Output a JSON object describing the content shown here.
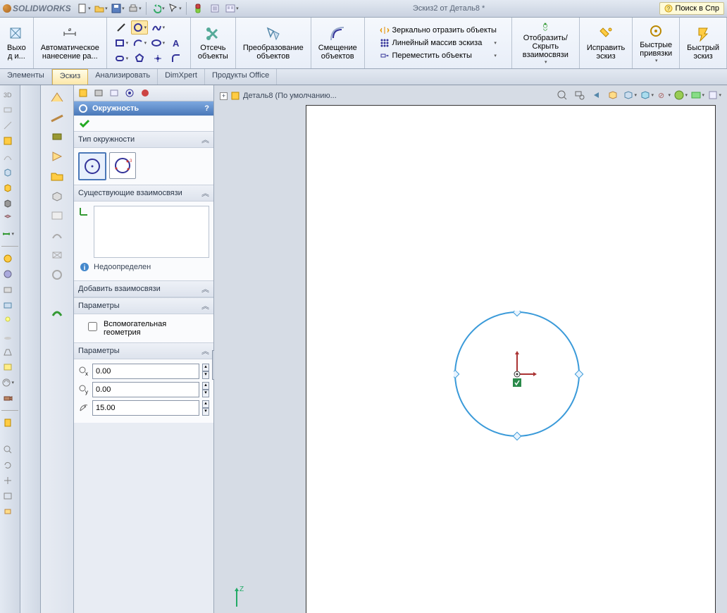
{
  "app": {
    "name": "SOLIDWORKS",
    "title": "Эскиз2 от Деталь8 *",
    "search": "Поиск в Спр"
  },
  "ribbon": {
    "exit": "Выхо\nд и...",
    "auto_dim": "Автоматическое\nнанесение ра...",
    "trim": "Отсечь\nобъекты",
    "convert": "Преобразование\nобъектов",
    "offset": "Смещение\nобъектов",
    "mirror": "Зеркально отразить объекты",
    "linear": "Линейный массив эскиза",
    "move": "Переместить объекты",
    "show_hide": "Отобразить/Скрыть\nвзаимосвязи",
    "fix": "Исправить\nэскиз",
    "quick_snap": "Быстрые\nпривязки",
    "quick_sketch": "Быстрый\nэскиз"
  },
  "tabs": {
    "features": "Элементы",
    "sketch": "Эскиз",
    "analyze": "Анализировать",
    "dimxpert": "DimXpert",
    "office": "Продукты Office"
  },
  "panel": {
    "title": "Окружность",
    "type_h": "Тип окружности",
    "relations_h": "Существующие взаимосвязи",
    "under_defined": "Недоопределен",
    "add_rel_h": "Добавить взаимосвязи",
    "params_h": "Параметры",
    "aux_geom": "Вспомогательная\nгеометрия",
    "params2_h": "Параметры",
    "cx": "0.00",
    "cy": "0.00",
    "r": "15.00"
  },
  "doc": {
    "tree": "Деталь8  (По умолчанию..."
  }
}
